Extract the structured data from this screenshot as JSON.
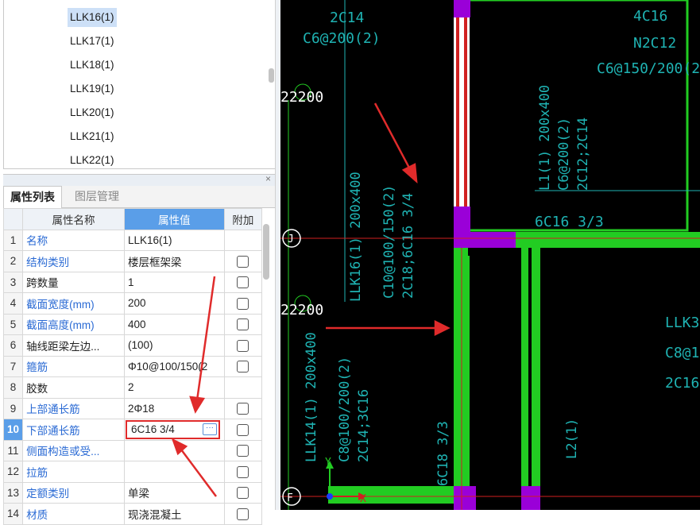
{
  "tree": {
    "items": [
      "LLK16(1)",
      "LLK17(1)",
      "LLK18(1)",
      "LLK19(1)",
      "LLK20(1)",
      "LLK21(1)",
      "LLK22(1)"
    ],
    "selected_index": 0
  },
  "panel": {
    "close_label": "×",
    "tabs": [
      "属性列表",
      "图层管理"
    ]
  },
  "grid": {
    "headers": [
      "属性名称",
      "属性值",
      "附加"
    ],
    "rows": [
      {
        "num": "1",
        "name": "名称",
        "value": "LLK16(1)"
      },
      {
        "num": "2",
        "name": "结构类别",
        "value": "楼层框架梁"
      },
      {
        "num": "3",
        "name": "跨数量",
        "value": "1"
      },
      {
        "num": "4",
        "name": "截面宽度(mm)",
        "value": "200"
      },
      {
        "num": "5",
        "name": "截面高度(mm)",
        "value": "400"
      },
      {
        "num": "6",
        "name": "轴线距梁左边...",
        "value": "(100)"
      },
      {
        "num": "7",
        "name": "箍筋",
        "value": "Φ10@100/150(2"
      },
      {
        "num": "8",
        "name": "胶数",
        "value": "2"
      },
      {
        "num": "9",
        "name": "上部通长筋",
        "value": "2Φ18"
      },
      {
        "num": "10",
        "name": "下部通长筋",
        "value": "6C16 3/4"
      },
      {
        "num": "11",
        "name": "侧面构造或受...",
        "value": ""
      },
      {
        "num": "12",
        "name": "拉筋",
        "value": ""
      },
      {
        "num": "13",
        "name": "定额类别",
        "value": "单梁"
      },
      {
        "num": "14",
        "name": "材质",
        "value": "现浇混凝土"
      }
    ],
    "edit_button": "···"
  },
  "cad": {
    "axis_labels": {
      "x": "X",
      "y": "Y"
    },
    "grid_bubbles": [
      "J",
      "F"
    ],
    "texts": {
      "t1": "2C14",
      "t2": "C6@200(2)",
      "t3": "4C16",
      "t4": "N2C12",
      "t5": "C6@150/200(2",
      "t6": "22200",
      "t7": "22200",
      "t8": "L1(1) 200x400",
      "t9": "C6@200(2)",
      "t10": "2C12;2C14",
      "t11": "LLK16(1) 200x400",
      "t12": "C10@100/150(2)",
      "t13": "2C18;6C16 3/4",
      "t14": "6C16 3/3",
      "t15": "LLK14(1) 200x400",
      "t16": "C8@100/200(2)",
      "t17": "2C14;3C16",
      "t18": "6C18 3/3",
      "t19": "L2(1)",
      "t20": "LLK3",
      "t21": "C8@1",
      "t22": "2C16"
    }
  },
  "colors": {
    "cad_background": "#000000",
    "beam_green": "#22cc22",
    "column_magenta": "#9a00d8",
    "cad_text_cyan": "#1fb3b3",
    "axis_red": "#d02020",
    "selected_blue": "#5a9ee8",
    "annotation_arrow": "#e02b2b"
  }
}
